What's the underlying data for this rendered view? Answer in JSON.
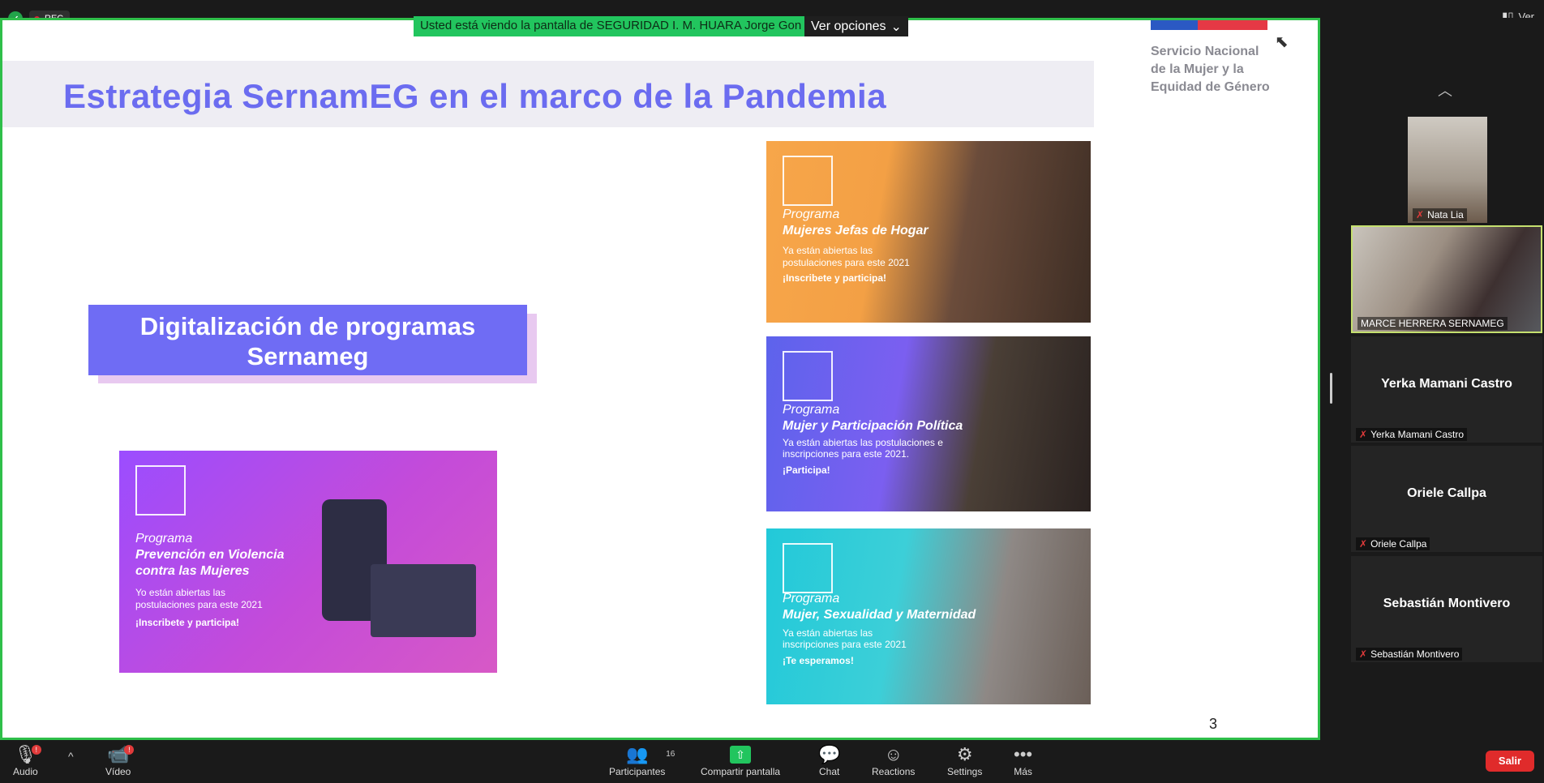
{
  "status": {
    "rec_label": "REC",
    "view_label": "Ver"
  },
  "banner": {
    "message": "Usted está viendo la pantalla de SEGURIDAD I. M. HUARA Jorge Gon",
    "options_label": "Ver opciones"
  },
  "slide": {
    "logo": [
      "Servicio Nacional",
      "de la Mujer y la",
      "Equidad de Género"
    ],
    "title": "Estrategia SernamEG en el marco de la Pandemia",
    "digital_box": [
      "Digitalización de programas",
      "Sernameg"
    ],
    "page_number": "3",
    "posters": [
      {
        "program": "Programa",
        "name": [
          "Prevención en Violencia",
          "contra las Mujeres"
        ],
        "sub": [
          "Yo están abiertas las",
          "postulaciones para este 2021"
        ],
        "cta": "¡Inscribete y participa!"
      },
      {
        "program": "Programa",
        "name": [
          "Mujeres Jefas de Hogar"
        ],
        "sub": [
          "Ya están abiertas las",
          "postulaciones para este 2021"
        ],
        "cta": "¡Inscribete y participa!"
      },
      {
        "program": "Programa",
        "name": [
          "Mujer y Participación Política"
        ],
        "sub": [
          "Ya están abiertas las postulaciones e",
          "inscripciones para este 2021."
        ],
        "cta": "¡Participa!"
      },
      {
        "program": "Programa",
        "name": [
          "Mujer, Sexualidad y Maternidad"
        ],
        "sub": [
          "Ya están abiertas las",
          "inscripciones para este 2021"
        ],
        "cta": "¡Te esperamos!"
      }
    ]
  },
  "participants_panel": [
    {
      "name": "Nata Lia",
      "video": true
    },
    {
      "name": "MARCE HERRERA SERNAMEG",
      "video": true
    },
    {
      "name": "Yerka Mamani Castro",
      "video": false
    },
    {
      "name": "Oriele Callpa",
      "video": false
    },
    {
      "name": "Sebastián Montivero",
      "video": false
    }
  ],
  "toolbar": {
    "audio": "Audio",
    "video": "Vídeo",
    "participants": "Participantes",
    "participants_count": "16",
    "share": "Compartir pantalla",
    "chat": "Chat",
    "reactions": "Reactions",
    "settings": "Settings",
    "more": "Más",
    "leave": "Salir"
  }
}
